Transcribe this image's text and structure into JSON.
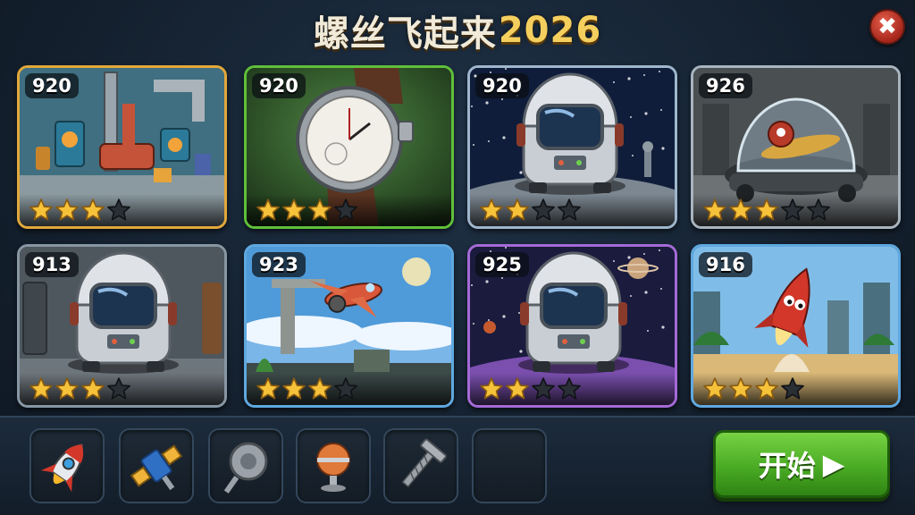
{
  "title": {
    "main": "螺丝飞起来",
    "year": "2026"
  },
  "close_button": {
    "label": "✖"
  },
  "levels": [
    {
      "level": "920",
      "stars": 3,
      "max_stars": 4,
      "scene": "pipe-room",
      "border": "#e2a83a"
    },
    {
      "level": "920",
      "stars": 3,
      "max_stars": 4,
      "scene": "pocket-watch",
      "border": "#5fbf3a"
    },
    {
      "level": "920",
      "stars": 2,
      "max_stars": 4,
      "scene": "space-capsule-space",
      "border": "#9fb6cc"
    },
    {
      "level": "926",
      "stars": 3,
      "max_stars": 5,
      "scene": "glass-dome",
      "border": "#a8b4bf"
    },
    {
      "level": "913",
      "stars": 3,
      "max_stars": 4,
      "scene": "space-capsule-room",
      "border": "#8796a3"
    },
    {
      "level": "923",
      "stars": 3,
      "max_stars": 4,
      "scene": "airplane-ruins",
      "border": "#5fa8e0"
    },
    {
      "level": "925",
      "stars": 2,
      "max_stars": 4,
      "scene": "space-capsule-purple",
      "border": "#a46ad6"
    },
    {
      "level": "916",
      "stars": 3,
      "max_stars": 4,
      "scene": "rocket-city",
      "border": "#5fa8e0"
    }
  ],
  "inventory": [
    {
      "icon": "rocket-icon"
    },
    {
      "icon": "satellite-icon"
    },
    {
      "icon": "gear-screw-icon"
    },
    {
      "icon": "orb-lamp-icon"
    },
    {
      "icon": "screw-icon"
    },
    {
      "icon": "empty-slot"
    }
  ],
  "start_button": {
    "label": "开始",
    "arrow": "▶"
  },
  "colors": {
    "star_on": "#f5c23a",
    "star_off": "#2a2f36",
    "accent_green": "#4aab24",
    "close_red": "#c0392b"
  }
}
